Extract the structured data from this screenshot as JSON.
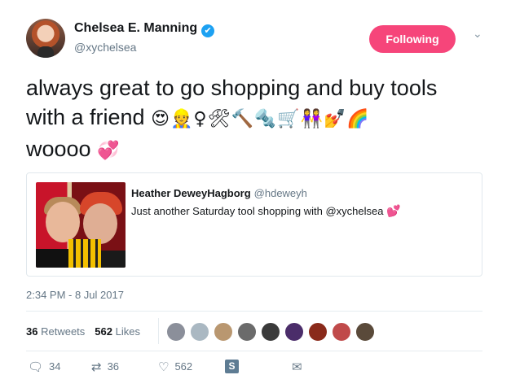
{
  "author": {
    "name": "Chelsea E. Manning",
    "verified_badge": "✔",
    "handle": "@xychelsea",
    "follow_label": "Following",
    "follow_color": "#f6457a",
    "menu_caret": "⌄"
  },
  "tweet": {
    "line1": "always great to go shopping and buy tools",
    "line2_text": "with a friend",
    "line2_emojis": "😍👷♀🛠🔨🔩🛒👭💅🌈",
    "line3_text": "woooo",
    "line3_emoji": "💞"
  },
  "quote": {
    "name": "Heather DeweyHagborg",
    "handle": "@hdeweyh",
    "text": "Just another Saturday tool shopping with @xychelsea",
    "emoji": "💕"
  },
  "timestamp": "2:34 PM - 8 Jul 2017",
  "stats": {
    "retweets_count": "36",
    "retweets_label": "Retweets",
    "likes_count": "562",
    "likes_label": "Likes"
  },
  "actions": {
    "reply_icon": "🗨",
    "reply_count": "34",
    "retweet_icon": "⇄",
    "retweet_count": "36",
    "like_icon": "♡",
    "like_count": "562",
    "share_s_icon": "S",
    "dm_icon": "✉"
  },
  "colors": {
    "accent": "#1da1f2",
    "muted_text": "#657786",
    "border": "#e1e8ed"
  },
  "liker_avatars": [
    "#8b8f9a",
    "#aab8c2",
    "#b99770",
    "#6b6b6b",
    "#3a3a3a",
    "#4b2d6a",
    "#8a2a1a",
    "#c04a4a",
    "#5a4a3a"
  ]
}
